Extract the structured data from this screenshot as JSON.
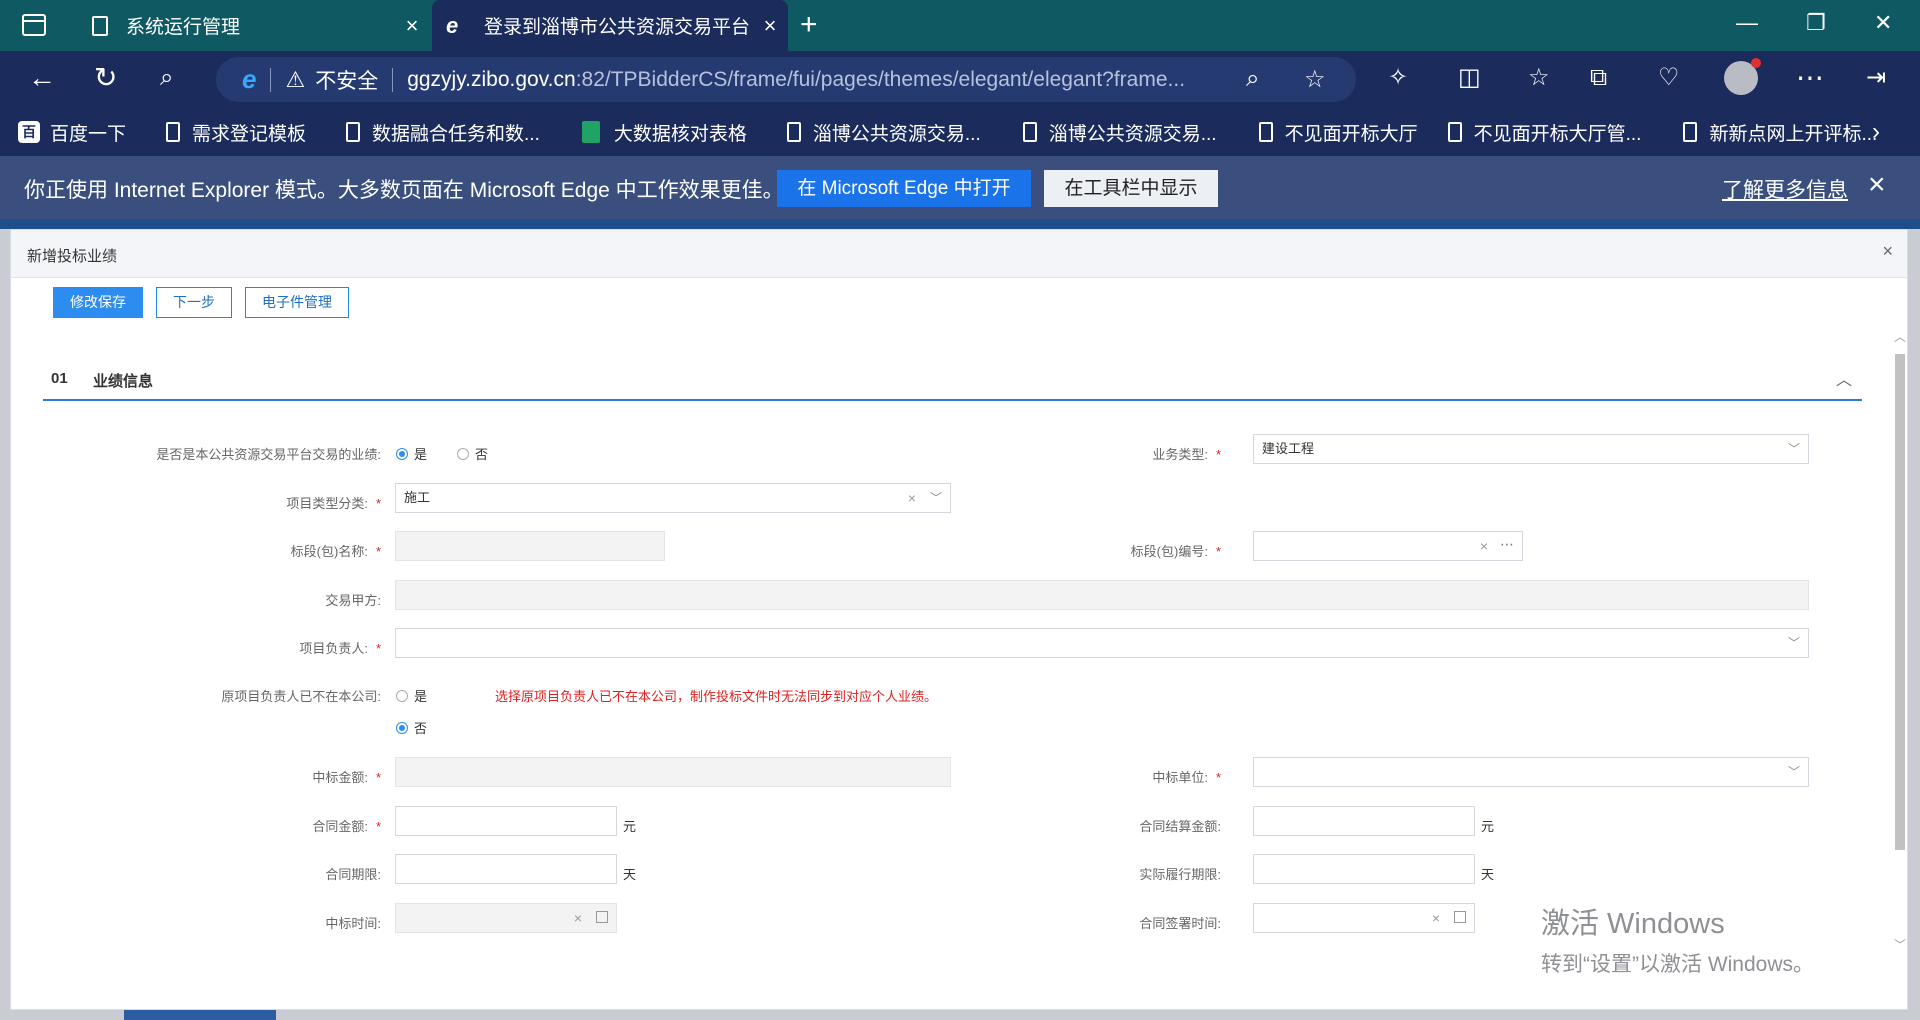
{
  "browser": {
    "tabs": [
      {
        "title": "系统运行管理"
      },
      {
        "title": "登录到淄博市公共资源交易平台"
      }
    ],
    "address": {
      "security": "不安全",
      "host": "ggzyjy.zibo.gov.cn",
      "path": ":82/TPBidderCS/frame/fui/pages/themes/elegant/elegant?frame..."
    },
    "bookmarks": [
      {
        "label": "百度一下",
        "icon": "baidu-icon"
      },
      {
        "label": "需求登记模板",
        "icon": "page-icon"
      },
      {
        "label": "数据融合任务和数...",
        "icon": "page-icon"
      },
      {
        "label": "大数据核对表格",
        "icon": "sheet-icon"
      },
      {
        "label": "淄博公共资源交易...",
        "icon": "page-icon"
      },
      {
        "label": "淄博公共资源交易...",
        "icon": "page-icon"
      },
      {
        "label": "不见面开标大厅",
        "icon": "page-icon"
      },
      {
        "label": "不见面开标大厅管...",
        "icon": "page-icon"
      },
      {
        "label": "新新点网上开评标...",
        "icon": "page-icon"
      }
    ],
    "iebar": {
      "message": "你正使用 Internet Explorer 模式。大多数页面在 Microsoft Edge 中工作效果更佳。",
      "open_label": "在 Microsoft Edge 中打开",
      "toolbar_label": "在工具栏中显示",
      "learn_more": "了解更多信息"
    }
  },
  "dialog": {
    "title": "新增投标业绩",
    "buttons": {
      "save": "修改保存",
      "next": "下一步",
      "files": "电子件管理"
    },
    "section": {
      "num": "01",
      "name": "业绩信息"
    },
    "fields": {
      "is_platform": {
        "label": "是否是本公共资源交易平台交易的业绩:",
        "yes": "是",
        "no": "否",
        "value": "是"
      },
      "business_type": {
        "label": "业务类型:",
        "value": "建设工程"
      },
      "project_type": {
        "label": "项目类型分类:",
        "value": "施工"
      },
      "section_name": {
        "label": "标段(包)名称:",
        "value": ""
      },
      "section_code": {
        "label": "标段(包)编号:",
        "value": ""
      },
      "party_a": {
        "label": "交易甲方:",
        "value": ""
      },
      "pm": {
        "label": "项目负责人:",
        "value": ""
      },
      "pm_left": {
        "label": "原项目负责人已不在本公司:",
        "yes": "是",
        "no": "否",
        "value": "否",
        "warning": "选择原项目负责人已不在本公司，制作投标文件时无法同步到对应个人业绩。"
      },
      "bid_amount": {
        "label": "中标金额:",
        "value": ""
      },
      "bid_unit": {
        "label": "中标单位:",
        "value": ""
      },
      "contract_amount": {
        "label": "合同金额:",
        "value": "",
        "unit": "元"
      },
      "settle_amount": {
        "label": "合同结算金额:",
        "value": "",
        "unit": "元"
      },
      "contract_period": {
        "label": "合同期限:",
        "value": "",
        "unit": "天"
      },
      "actual_period": {
        "label": "实际履行期限:",
        "value": "",
        "unit": "天"
      },
      "bid_time": {
        "label": "中标时间:",
        "value": ""
      },
      "sign_time": {
        "label": "合同签署时间:",
        "value": ""
      }
    }
  },
  "watermark": {
    "line1": "激活 Windows",
    "line2": "转到“设置”以激活 Windows。"
  }
}
